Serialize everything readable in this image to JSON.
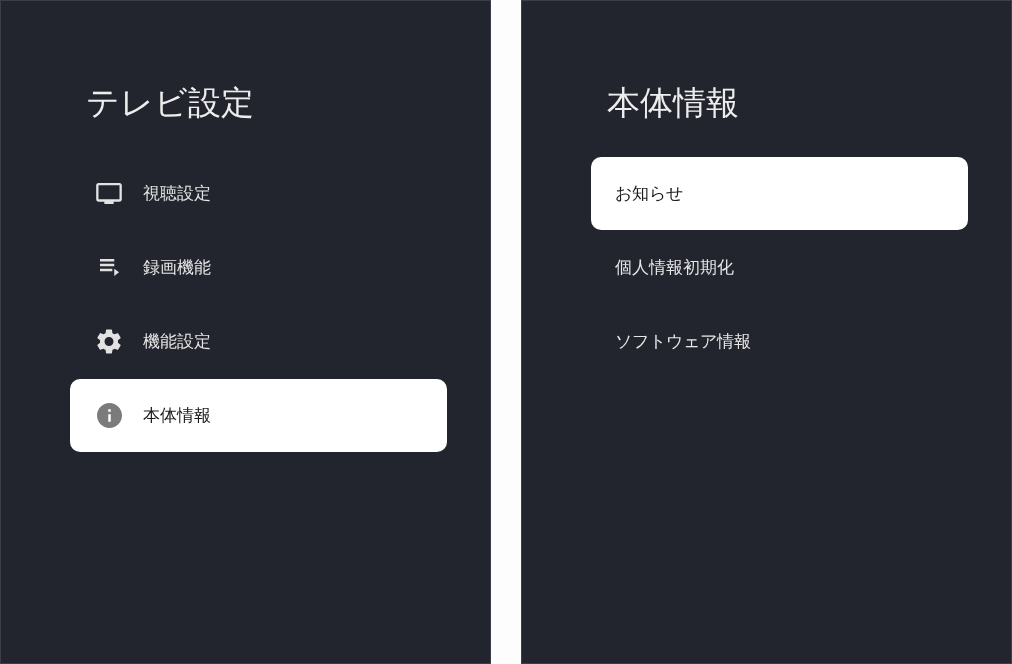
{
  "settings_panel": {
    "title": "テレビ設定",
    "items": [
      {
        "label": "視聴設定",
        "selected": false
      },
      {
        "label": "録画機能",
        "selected": false
      },
      {
        "label": "機能設定",
        "selected": false
      },
      {
        "label": "本体情報",
        "selected": true
      }
    ]
  },
  "info_panel": {
    "title": "本体情報",
    "items": [
      {
        "label": "お知らせ",
        "selected": true
      },
      {
        "label": "個人情報初期化",
        "selected": false
      },
      {
        "label": "ソフトウェア情報",
        "selected": false
      }
    ]
  }
}
